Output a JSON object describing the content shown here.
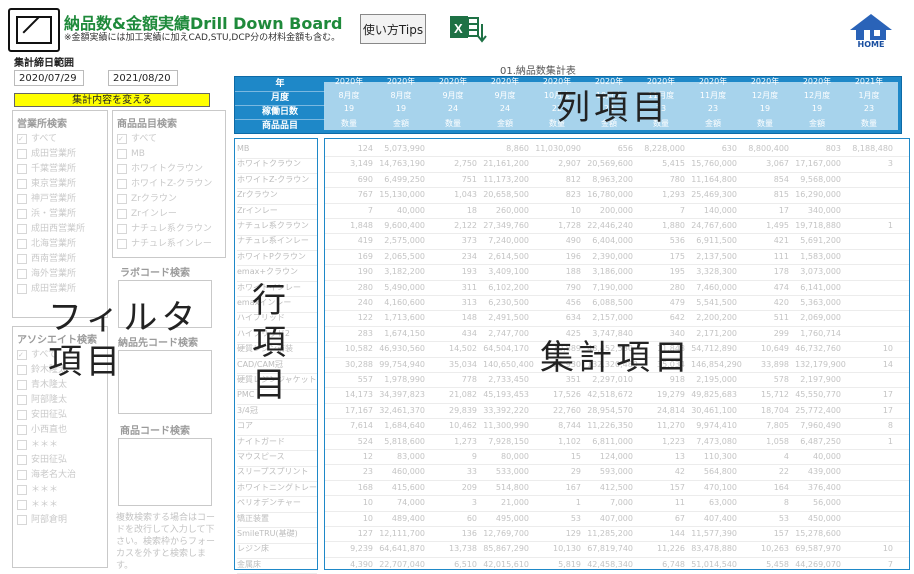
{
  "header": {
    "title": "納品数&金額実績Drill Down Board",
    "subtitle": "※金額実績には加工実績に加えCAD,STU,DCP分の材料金額も含む。",
    "help_label": "使い方Tips",
    "home_label": "HOME"
  },
  "filters": {
    "range_label": "集計締日範囲",
    "date_from": "2020/07/29",
    "date_to": "2021/08/20",
    "change_button": "集計内容を変える",
    "office_title": "営業所検索",
    "office_items": [
      "すべて",
      "成田営業所",
      "千葉営業所",
      "東京営業所",
      "神戸営業所",
      "浜・営業所",
      "成田西営業所",
      "北海営業所",
      "西南営業所",
      "海外営業所",
      "成田営業所"
    ],
    "product_title": "商品品目検索",
    "product_items": [
      "すべて",
      "MB",
      "ホワイトクラウン",
      "ホワイトZ-クラウン",
      "Zrクラウン",
      "Zrインレー",
      "ナチュレ系クラウン",
      "ナチュレ系インレー"
    ],
    "lab_title": "ラボコード検索",
    "assoc_title": "アソシエイト検索",
    "assoc_items": [
      "すべて",
      "鈴木隆太",
      "青木隆太",
      "阿部隆太",
      "安田征弘",
      "小西直也",
      "＊＊＊",
      "安田征弘",
      "海老名大治",
      "＊＊＊",
      "＊＊＊",
      "阿部倉明"
    ],
    "dest_title": "納品先コード検索",
    "code_title": "商品コード検索",
    "note": "複数検索する場合はコードを改行して入力して下さい。検索枠からフォーカスを外すと検索します。"
  },
  "overlay": {
    "filter_label": "フィルタ項目",
    "row_label": "行項目",
    "col_label": "列項目",
    "agg_label": "集計項目"
  },
  "table": {
    "title": "01.納品数集計表",
    "header_rows": [
      "年",
      "月度",
      "稼働日数",
      "商品品目"
    ],
    "years": [
      "2020年",
      "2020年",
      "2020年",
      "2020年",
      "2020年",
      "2020年",
      "2020年",
      "2020年",
      "2020年",
      "2020年",
      "2021年"
    ],
    "months": [
      "8月度",
      "8月度",
      "9月度",
      "9月度",
      "10月度",
      "10月度",
      "11月度",
      "11月度",
      "12月度",
      "12月度",
      "1月度"
    ],
    "days": [
      "19",
      "19",
      "24",
      "24",
      "22",
      "22",
      "23",
      "23",
      "19",
      "19",
      "23"
    ],
    "metric": [
      "数量",
      "金額",
      "数量",
      "金額",
      "数量",
      "金額",
      "数量",
      "金額",
      "数量",
      "金額",
      "数量"
    ],
    "row_labels": [
      "MB",
      "ホワイトクラウン",
      "ホワイトZ-クラウン",
      "Zrクラウン",
      "Zrインレー",
      "ナチュレ系クラウン",
      "ナチュレ系インレー",
      "ホワイトPクラウン",
      "emax+クラウン",
      "ホワイトインレー",
      "emaxインレー",
      "ハイブリッド",
      "ハイブリッド2",
      "硬質レジン前装",
      "CAD/CAM冠",
      "硬質レジンジャケット",
      "PMC",
      "3/4冠",
      "コア",
      "ナイトガード",
      "マウスピース",
      "スリープスプリント",
      "ホワイトニングトレー",
      "ペリオデンチャー",
      "矯正装置",
      "SmileTRU(基礎)",
      "レジン床",
      "金属床"
    ],
    "rows": [
      [
        "124",
        "5,073,990",
        "",
        "8,860",
        "11,030,090",
        "656",
        "8,228,000",
        "630",
        "8,800,400",
        "803",
        "8,188,480",
        ""
      ],
      [
        "3,149",
        "14,763,190",
        "2,750",
        "21,161,200",
        "2,907",
        "20,569,600",
        "5,415",
        "15,760,000",
        "3,067",
        "17,167,000",
        "3"
      ],
      [
        "690",
        "6,499,250",
        "751",
        "11,173,200",
        "812",
        "8,963,200",
        "780",
        "11,164,800",
        "854",
        "9,568,000",
        ""
      ],
      [
        "767",
        "15,130,000",
        "1,043",
        "20,658,500",
        "823",
        "16,780,000",
        "1,293",
        "25,469,300",
        "815",
        "16,290,000",
        ""
      ],
      [
        "7",
        "40,000",
        "18",
        "260,000",
        "10",
        "200,000",
        "7",
        "140,000",
        "17",
        "340,000",
        ""
      ],
      [
        "1,848",
        "9,600,400",
        "2,122",
        "27,349,760",
        "1,728",
        "22,446,240",
        "1,880",
        "24,767,600",
        "1,495",
        "19,718,880",
        "1"
      ],
      [
        "419",
        "2,575,000",
        "373",
        "7,240,000",
        "490",
        "6,404,000",
        "536",
        "6,911,500",
        "421",
        "5,691,200",
        ""
      ],
      [
        "169",
        "2,065,500",
        "234",
        "2,614,500",
        "196",
        "2,390,000",
        "175",
        "2,137,500",
        "111",
        "1,583,000",
        ""
      ],
      [
        "190",
        "3,182,200",
        "193",
        "3,409,100",
        "188",
        "3,186,000",
        "195",
        "3,328,300",
        "178",
        "3,073,000",
        ""
      ],
      [
        "280",
        "5,490,000",
        "311",
        "6,102,200",
        "790",
        "7,190,000",
        "280",
        "7,460,000",
        "474",
        "6,141,000",
        ""
      ],
      [
        "240",
        "4,160,600",
        "313",
        "6,230,500",
        "456",
        "6,088,500",
        "479",
        "5,541,500",
        "420",
        "5,363,000",
        ""
      ],
      [
        "122",
        "1,713,600",
        "148",
        "2,491,500",
        "634",
        "2,157,000",
        "642",
        "2,200,200",
        "511",
        "2,069,000",
        ""
      ],
      [
        "283",
        "1,674,150",
        "434",
        "2,747,700",
        "425",
        "3,747,840",
        "340",
        "2,171,200",
        "299",
        "1,760,714",
        ""
      ],
      [
        "10,582",
        "46,930,560",
        "14,502",
        "64,504,170",
        "10,889",
        "48,452,530",
        "11,848",
        "54,712,890",
        "10,649",
        "46,732,760",
        "10"
      ],
      [
        "30,288",
        "99,754,940",
        "35,034",
        "140,650,400",
        "28,930",
        "132,320,480",
        "35,034",
        "146,854,290",
        "33,898",
        "132,179,900",
        "14"
      ],
      [
        "557",
        "1,978,990",
        "778",
        "2,733,450",
        "351",
        "2,297,010",
        "918",
        "2,195,000",
        "578",
        "2,197,900",
        ""
      ],
      [
        "14,173",
        "34,397,823",
        "21,082",
        "45,193,453",
        "17,526",
        "42,518,672",
        "19,279",
        "49,825,683",
        "15,712",
        "45,550,770",
        "17"
      ],
      [
        "17,167",
        "32,461,370",
        "29,839",
        "33,392,220",
        "22,760",
        "28,954,570",
        "24,814",
        "30,461,100",
        "18,704",
        "25,772,400",
        "17"
      ],
      [
        "7,614",
        "1,684,640",
        "10,462",
        "11,300,990",
        "8,744",
        "11,226,350",
        "11,270",
        "9,974,410",
        "7,805",
        "7,960,490",
        "8"
      ],
      [
        "524",
        "5,818,600",
        "1,273",
        "7,928,150",
        "1,102",
        "6,811,000",
        "1,223",
        "7,473,080",
        "1,058",
        "6,487,250",
        "1"
      ],
      [
        "12",
        "83,000",
        "9",
        "80,000",
        "15",
        "124,000",
        "13",
        "110,300",
        "4",
        "40,000",
        ""
      ],
      [
        "23",
        "460,000",
        "33",
        "533,000",
        "29",
        "593,000",
        "42",
        "564,800",
        "22",
        "439,000",
        ""
      ],
      [
        "168",
        "415,600",
        "209",
        "514,800",
        "167",
        "412,500",
        "157",
        "470,100",
        "164",
        "376,400",
        ""
      ],
      [
        "10",
        "74,000",
        "3",
        "21,000",
        "1",
        "7,000",
        "11",
        "63,000",
        "8",
        "56,000",
        ""
      ],
      [
        "10",
        "489,400",
        "60",
        "495,000",
        "53",
        "407,000",
        "67",
        "407,400",
        "53",
        "450,000",
        ""
      ],
      [
        "127",
        "12,111,700",
        "136",
        "12,769,700",
        "129",
        "11,285,200",
        "144",
        "11,577,390",
        "157",
        "15,278,600",
        ""
      ],
      [
        "9,239",
        "64,641,870",
        "13,738",
        "85,867,290",
        "10,130",
        "67,819,740",
        "11,226",
        "83,478,880",
        "10,263",
        "69,587,970",
        "10"
      ],
      [
        "4,390",
        "22,707,040",
        "6,510",
        "42,015,610",
        "5,819",
        "42,458,340",
        "6,748",
        "51,014,540",
        "5,458",
        "44,269,070",
        "7"
      ]
    ]
  }
}
